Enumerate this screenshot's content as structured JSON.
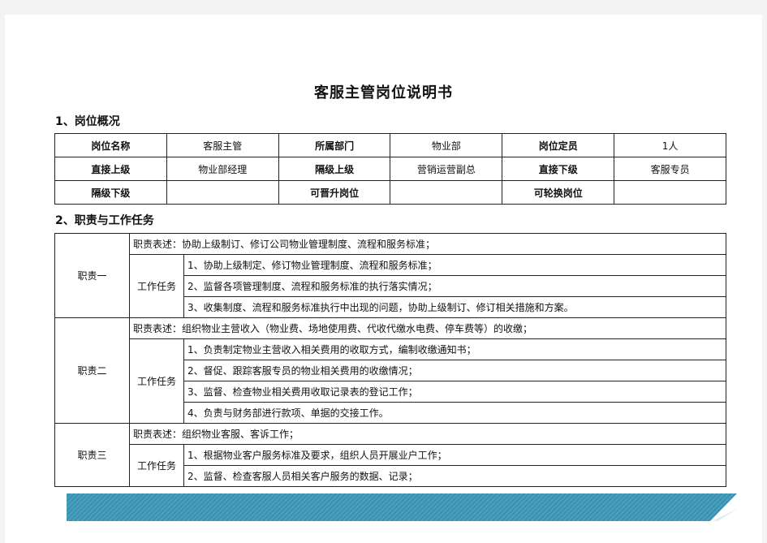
{
  "doc": {
    "title": "客服主管岗位说明书",
    "section1": "1、岗位概况",
    "section2": "2、职责与工作任务"
  },
  "overview": {
    "r1": [
      "岗位名称",
      "客服主管",
      "所属部门",
      "物业部",
      "岗位定员",
      "1人"
    ],
    "r2": [
      "直接上级",
      "物业部经理",
      "隔级上级",
      "营销运营副总",
      "直接下级",
      "客服专员"
    ],
    "r3": [
      "隔级下级",
      "",
      "可晋升岗位",
      "",
      "可轮换岗位",
      ""
    ]
  },
  "duties": [
    {
      "name": "职责一",
      "desc": "职责表述：协助上级制订、修订公司物业管理制度、流程和服务标准；",
      "task_label": "工作任务",
      "tasks": [
        "1、协助上级制定、修订物业管理制度、流程和服务标准；",
        "2、监督各项管理制度、流程和服务标准的执行落实情况；",
        "3、收集制度、流程和服务标准执行中出现的问题，协助上级制订、修订相关措施和方案。"
      ]
    },
    {
      "name": "职责二",
      "desc": "职责表述：组织物业主营收入（物业费、场地使用费、代收代缴水电费、停车费等）的收缴；",
      "task_label": "工作任务",
      "tasks": [
        "1、负责制定物业主营收入相关费用的收取方式，编制收缴通知书；",
        "2、督促、跟踪客服专员的物业相关费用的收缴情况；",
        "3、监督、检查物业相关费用收取记录表的登记工作；",
        "4、负责与财务部进行款项、单据的交接工作。"
      ]
    },
    {
      "name": "职责三",
      "desc": "职责表述：组织物业客服、客诉工作；",
      "task_label": "工作任务",
      "tasks": [
        "1、根据物业客户服务标准及要求，组织人员开展业户工作；",
        "2、监督、检查客服人员相关客户服务的数据、记录；"
      ]
    }
  ]
}
